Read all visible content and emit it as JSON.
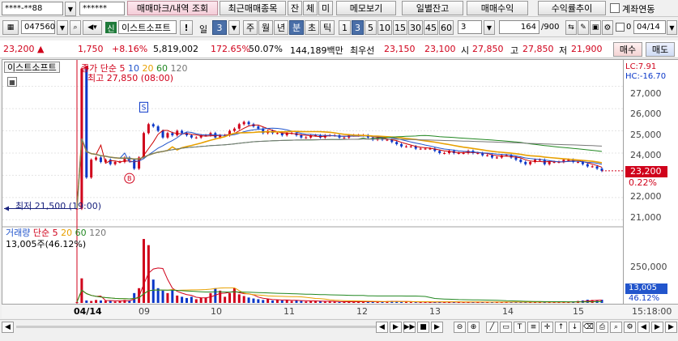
{
  "toolbar1": {
    "account": "****-**88",
    "password": "******",
    "buttons": [
      "매매마크/내역 조회",
      "최근매매종목",
      "잔",
      "체",
      "미",
      "메모보기",
      "일별잔고",
      "매매수익",
      "수익률추이"
    ],
    "link_label": "계좌연동"
  },
  "toolbar2": {
    "code": "047560",
    "badge": "신",
    "name": "이스트소프트",
    "bang": "!",
    "period_label": "일",
    "period_value": "3",
    "units": [
      "주",
      "월",
      "년",
      "분",
      "초",
      "틱"
    ],
    "active_unit": "분",
    "intervals": [
      "1",
      "3",
      "5",
      "10",
      "15",
      "30",
      "45",
      "60"
    ],
    "active_interval": "3",
    "bar_count": "3",
    "view_count": "164",
    "total_count": "/900",
    "zero_label": "0",
    "date": "04/14"
  },
  "quote": {
    "price": "23,200",
    "arrow": "▲",
    "change": "1,750",
    "change_pct": "+8.16%",
    "volume": "5,819,002",
    "vol_ratio": "172.65%",
    "percent2": "50.07%",
    "amount": "144,189백만",
    "priority_label": "최우선",
    "ask": "23,150",
    "bid": "23,100",
    "open_label": "시",
    "open": "27,850",
    "high_label": "고",
    "high": "27,850",
    "low_label": "저",
    "low": "21,900",
    "buy_label": "매수",
    "sell_label": "매도"
  },
  "price_panel": {
    "tab": "이스트소프트",
    "ma_label": "종가 단순",
    "ma_periods": [
      "5",
      "10",
      "20",
      "60",
      "120"
    ],
    "ma_colors": [
      "#cc0000",
      "#2255cc",
      "#e8a000",
      "#228822",
      "#777777"
    ],
    "high_annot": "최고 27,850 (08:00)",
    "low_annot": "최저 21,500 (19:00)",
    "lc": "LC:7.91",
    "hc": "HC:-16.70",
    "current_price": "23,200",
    "current_pct": "0.22%",
    "yticks": [
      "27,000",
      "26,000",
      "25,000",
      "24,000",
      "23,000",
      "22,000",
      "21,000"
    ],
    "signals": [
      "S",
      "B"
    ]
  },
  "volume_panel": {
    "label": "거래량",
    "ma_label": "단순",
    "ma_periods": [
      "5",
      "20",
      "60",
      "120"
    ],
    "sub": "13,005주(46.12%)",
    "ytick": "250,000",
    "current": "13,005",
    "current_pct": "46.12%"
  },
  "xaxis": {
    "labels": [
      "04/14",
      "09",
      "10",
      "11",
      "12",
      "13",
      "14",
      "15"
    ],
    "time": "15:18:00"
  },
  "chart_data": {
    "type": "candlestick",
    "title": "이스트소프트",
    "unit": "3분",
    "ylim": [
      20900,
      27900
    ],
    "high": 27850,
    "low": 21500,
    "close": [
      21500,
      27800,
      22900,
      23700,
      23800,
      23600,
      23700,
      23500,
      23600,
      23600,
      23800,
      23700,
      23300,
      23800,
      24900,
      25300,
      25200,
      25000,
      24700,
      24900,
      24800,
      25000,
      24900,
      24800,
      24700,
      24700,
      24800,
      24800,
      24900,
      24700,
      24800,
      24800,
      25000,
      25100,
      25300,
      25400,
      25300,
      25200,
      25100,
      24900,
      25000,
      24900,
      24900,
      24800,
      24900,
      24900,
      24800,
      24700,
      24700,
      24800,
      24800,
      24700,
      24800,
      24800,
      24800,
      24700,
      24700,
      24800,
      24800,
      24800,
      24800,
      24700,
      24600,
      24700,
      24600,
      24600,
      24500,
      24400,
      24300,
      24300,
      24300,
      24200,
      24200,
      24200,
      24200,
      24100,
      24000,
      24000,
      24100,
      24000,
      24000,
      24000,
      24100,
      24000,
      24000,
      23900,
      23900,
      23800,
      23800,
      23900,
      23900,
      23800,
      23700,
      23600,
      23500,
      23600,
      23700,
      23700,
      23500,
      23600,
      23600,
      23600,
      23700,
      23700,
      23600,
      23600,
      23500,
      23400,
      23400,
      23300,
      23200
    ],
    "volume": [
      4000,
      100000,
      10000,
      8000,
      12000,
      10000,
      9000,
      8000,
      6000,
      8000,
      12000,
      10000,
      40000,
      60000,
      260000,
      235000,
      95000,
      60000,
      50000,
      40000,
      55000,
      30000,
      25000,
      20000,
      25000,
      15000,
      20000,
      22000,
      40000,
      60000,
      50000,
      25000,
      40000,
      60000,
      35000,
      28000,
      22000,
      18000,
      15000,
      12000,
      16000,
      10000,
      12000,
      10000,
      12000,
      8000,
      10000,
      8000,
      6000,
      9000,
      8000,
      7000,
      5000,
      6000,
      5000,
      4000,
      5000,
      4000,
      5000,
      6000,
      5000,
      4000,
      5000,
      6000,
      5000,
      7000,
      8000,
      5000,
      4000,
      5000,
      4000,
      3000,
      4000,
      3000,
      4000,
      3000,
      5000,
      3000,
      4000,
      3000,
      4000,
      3000,
      4000,
      3000,
      4000,
      3000,
      4000,
      3000,
      4000,
      3000,
      4000,
      3000,
      4000,
      3000,
      4000,
      3000,
      4000,
      3000,
      4000,
      3000,
      4000,
      3000,
      4000,
      3000,
      5000,
      8000,
      10000,
      13005,
      12000,
      10000,
      13005
    ]
  },
  "bottom": {
    "nav": [
      "◀",
      "▶",
      "▶▶",
      "■",
      "▶"
    ]
  }
}
